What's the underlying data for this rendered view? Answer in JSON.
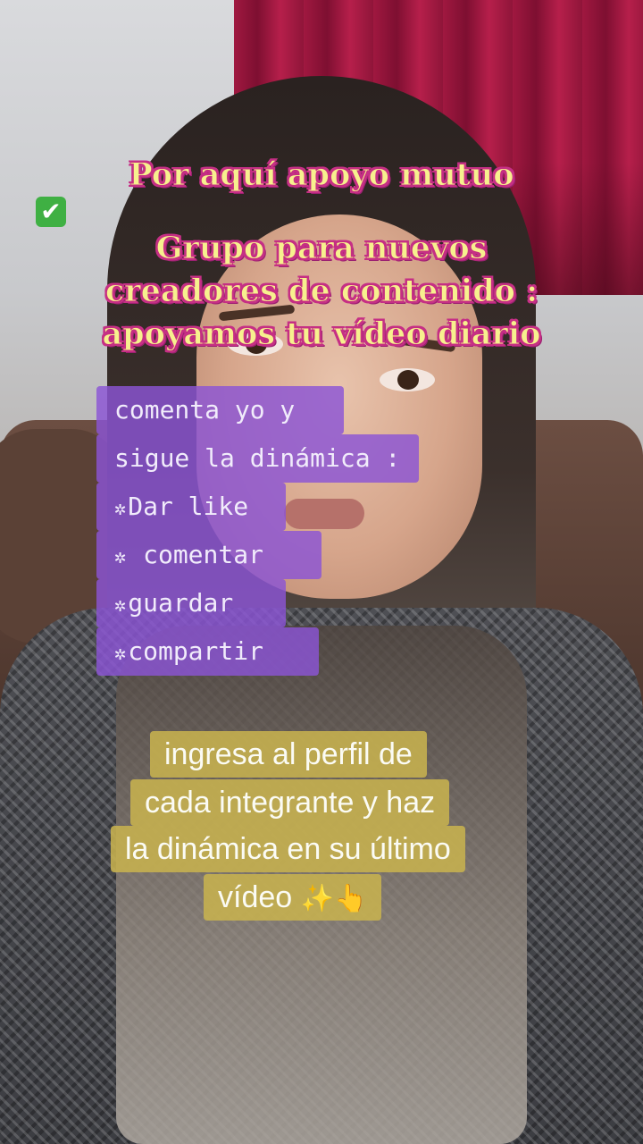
{
  "overlay_title": {
    "line1": "Por aquí apoyo mutuo",
    "check_emoji": "✔",
    "line2": "Grupo para nuevos",
    "line3": "creadores de contenido :",
    "line4": "apoyamos tu vídeo diario"
  },
  "instructions": {
    "line1": "comenta yo y",
    "line2": "sigue la dinámica :",
    "spark": "✲",
    "items": [
      "Dar like",
      " comentar",
      "guardar",
      "compartir"
    ]
  },
  "caption": {
    "line1": "ingresa al perfil de",
    "line2": "cada integrante y haz",
    "line3": "la dinámica en su último",
    "line4": "vídeo",
    "emoji1": "✨",
    "emoji2": "👆"
  },
  "colors": {
    "title_fill": "#f7f08e",
    "title_outline": "#c62f86",
    "purple_box": "#8b54d6",
    "yellow_box": "#c7b24e"
  }
}
